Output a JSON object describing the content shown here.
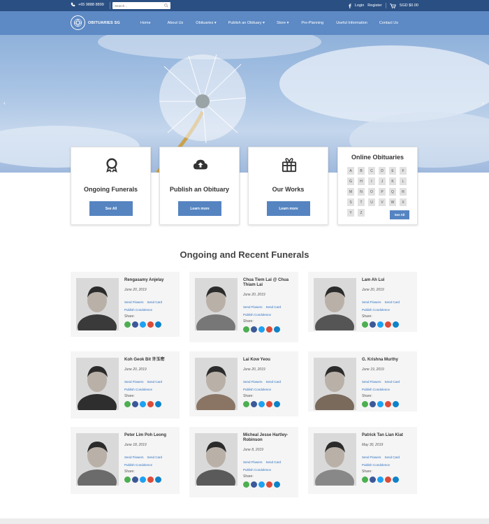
{
  "topbar": {
    "phone": "+65 9888 8899",
    "search_placeholder": "Search...",
    "login": "Login",
    "register": "Register",
    "cart": "SGD $0.00"
  },
  "brand": {
    "name": "OBITUARIES SG"
  },
  "nav": {
    "items": [
      {
        "label": "Home"
      },
      {
        "label": "About Us"
      },
      {
        "label": "Obituaries ▾"
      },
      {
        "label": "Publish an Obituary ▾"
      },
      {
        "label": "Store ▾"
      },
      {
        "label": "Pre-Planning"
      },
      {
        "label": "Useful Information"
      },
      {
        "label": "Contact Us"
      }
    ]
  },
  "features": {
    "ongoing": {
      "title": "Ongoing Funerals",
      "button": "See All"
    },
    "publish": {
      "title": "Publish an Obituary",
      "button": "Learn more"
    },
    "works": {
      "title": "Our Works",
      "button": "Learn more"
    },
    "online": {
      "title": "Online Obituaries",
      "button": "See All",
      "letters": [
        "A",
        "B",
        "C",
        "D",
        "E",
        "F",
        "G",
        "H",
        "I",
        "J",
        "K",
        "L",
        "M",
        "N",
        "O",
        "P",
        "Q",
        "R",
        "S",
        "T",
        "U",
        "V",
        "W",
        "X",
        "Y",
        "Z"
      ]
    }
  },
  "section_title": "Ongoing and Recent Funerals",
  "card_labels": {
    "send_flowers": "Send Flowers",
    "send_card": "Send Card",
    "publish_condolence": "Publish Condolence",
    "share": "Share:"
  },
  "funerals": [
    {
      "name": "Rengasamy Anjelay",
      "date": "June 20, 2019"
    },
    {
      "name": "Chua Tiem Lai @ Chua Thiam Lai",
      "date": "June 20, 2019"
    },
    {
      "name": "Lam Ah Lui",
      "date": "June 20, 2019"
    },
    {
      "name": "Koh Geok Bit 许玉密",
      "date": "June 20, 2019"
    },
    {
      "name": "Lai Kow Yeou",
      "date": "June 20, 2019"
    },
    {
      "name": "G. Krishna Murthy",
      "date": "June 19, 2019"
    },
    {
      "name": "Peter Lim Poh Leong",
      "date": "June 18, 2019"
    },
    {
      "name": "Micheal Jesse Hartley-Robinson",
      "date": "June 8, 2019"
    },
    {
      "name": "Patrick Tan Lian Kiat",
      "date": "May 30, 2019"
    }
  ],
  "colors": {
    "topbar": "#2a4f83",
    "nav": "#5d89c4",
    "button": "#5584c1",
    "link": "#2a6fc0",
    "whatsapp": "#4caf50",
    "facebook": "#3b5998",
    "twitter": "#1da1f2",
    "googleplus": "#dd4b39",
    "email": "#0f82c8"
  }
}
